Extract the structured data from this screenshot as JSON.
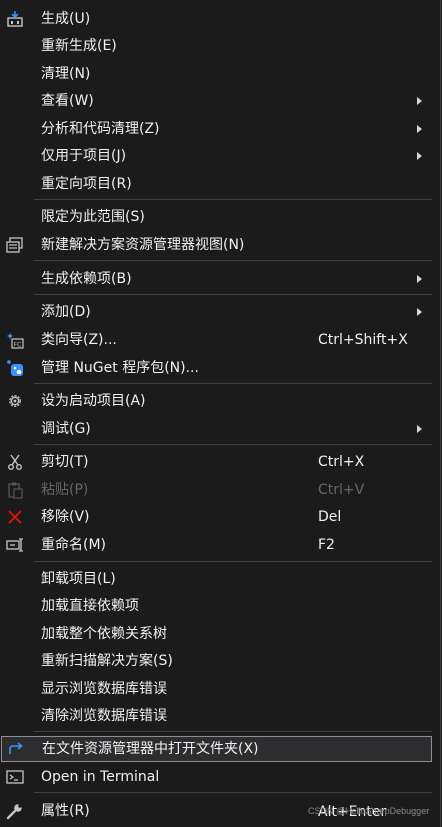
{
  "menu": {
    "items": [
      {
        "label": "生成(U)",
        "icon": "build-icon"
      },
      {
        "label": "重新生成(E)"
      },
      {
        "label": "清理(N)"
      },
      {
        "label": "查看(W)",
        "submenu": true
      },
      {
        "label": "分析和代码清理(Z)",
        "submenu": true
      },
      {
        "label": "仅用于项目(J)",
        "submenu": true
      },
      {
        "label": "重定向项目(R)"
      },
      {
        "label": "限定为此范围(S)"
      },
      {
        "label": "新建解决方案资源管理器视图(N)",
        "icon": "new-view-icon"
      },
      {
        "label": "生成依赖项(B)",
        "submenu": true
      },
      {
        "label": "添加(D)",
        "submenu": true
      },
      {
        "label": "类向导(Z)...",
        "shortcut": "Ctrl+Shift+X",
        "icon": "class-wizard-icon"
      },
      {
        "label": "管理 NuGet 程序包(N)...",
        "icon": "nuget-icon"
      },
      {
        "label": "设为启动项目(A)",
        "icon": "gear-icon"
      },
      {
        "label": "调试(G)",
        "submenu": true
      },
      {
        "label": "剪切(T)",
        "shortcut": "Ctrl+X",
        "icon": "scissors-icon"
      },
      {
        "label": "粘贴(P)",
        "shortcut": "Ctrl+V",
        "icon": "paste-icon",
        "disabled": true
      },
      {
        "label": "移除(V)",
        "shortcut": "Del",
        "icon": "remove-icon"
      },
      {
        "label": "重命名(M)",
        "shortcut": "F2",
        "icon": "rename-icon"
      },
      {
        "label": "卸载项目(L)"
      },
      {
        "label": "加载直接依赖项"
      },
      {
        "label": "加载整个依赖关系树"
      },
      {
        "label": "重新扫描解决方案(S)"
      },
      {
        "label": "显示浏览数据库错误"
      },
      {
        "label": "清除浏览数据库错误"
      },
      {
        "label": "在文件资源管理器中打开文件夹(X)",
        "icon": "open-folder-icon",
        "highlighted": true
      },
      {
        "label": "Open in Terminal",
        "icon": "terminal-icon"
      },
      {
        "label": "属性(R)",
        "shortcut": "Alt+Enter",
        "icon": "wrench-icon"
      }
    ]
  },
  "watermark": "CSDN @HelloSharpDebugger",
  "colors": {
    "background": "#1b1b1c",
    "separator": "#3f3f46",
    "text": "#f1f1f1",
    "disabled_text": "#656565",
    "highlight_border": "#8e8e92",
    "accent_blue": "#3794ff",
    "remove_red": "#e51400"
  }
}
